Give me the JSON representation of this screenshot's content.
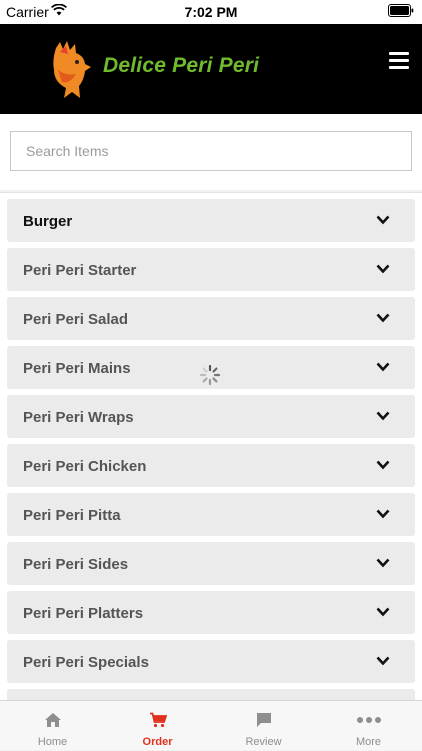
{
  "status_bar": {
    "carrier": "Carrier",
    "time": "7:02 PM"
  },
  "header": {
    "brand": "Delice Peri Peri",
    "logo_icon": "rooster-logo-icon",
    "menu_icon": "hamburger-menu-icon",
    "brand_color": "#6fbb2d"
  },
  "search": {
    "placeholder": "Search Items",
    "value": ""
  },
  "categories": [
    {
      "label": "Burger"
    },
    {
      "label": "Peri Peri Starter"
    },
    {
      "label": "Peri Peri Salad"
    },
    {
      "label": "Peri Peri Mains"
    },
    {
      "label": "Peri Peri Wraps"
    },
    {
      "label": "Peri Peri Chicken"
    },
    {
      "label": "Peri Peri Pitta"
    },
    {
      "label": "Peri Peri Sides"
    },
    {
      "label": "Peri Peri Platters"
    },
    {
      "label": "Peri Peri Specials"
    }
  ],
  "tabs": [
    {
      "label": "Home",
      "icon": "home-icon"
    },
    {
      "label": "Order",
      "icon": "cart-icon"
    },
    {
      "label": "Review",
      "icon": "chat-bubble-icon"
    },
    {
      "label": "More",
      "icon": "ellipsis-icon"
    }
  ],
  "colors": {
    "accent": "#e0301e",
    "header_bg": "#000000"
  }
}
